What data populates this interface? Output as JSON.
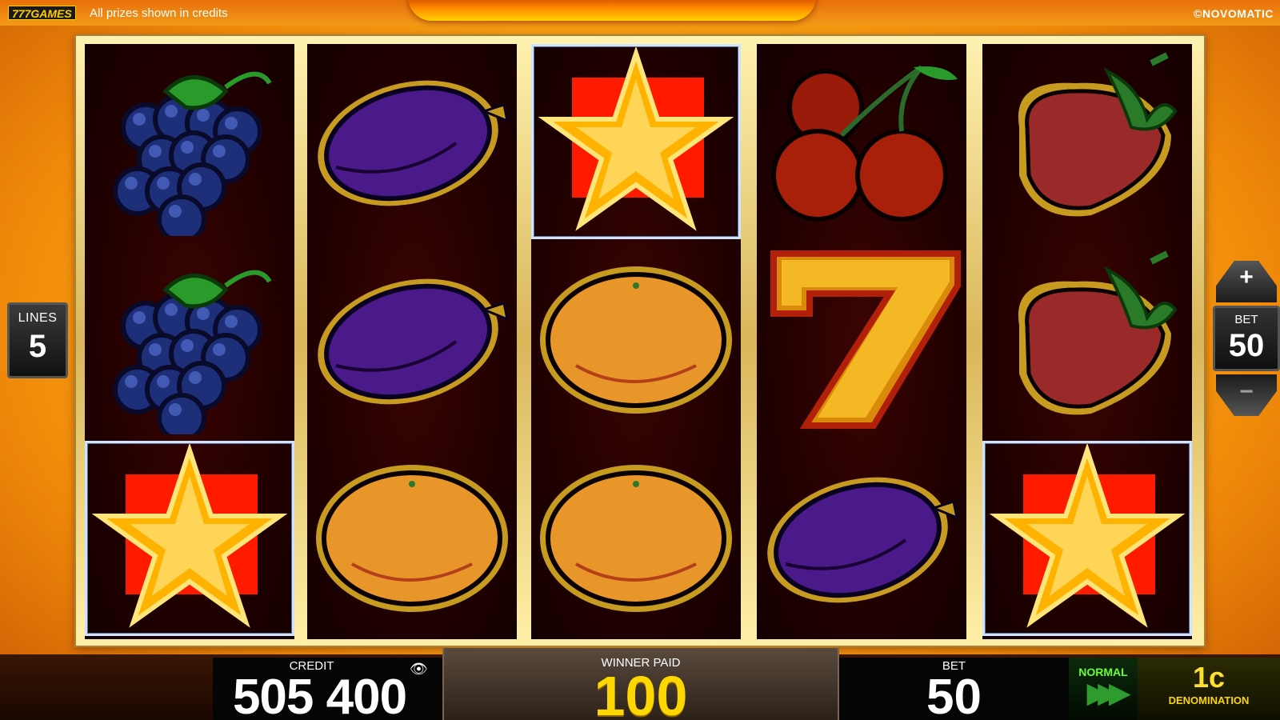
{
  "header": {
    "brand": "777GAMES",
    "prizes_note": "All prizes shown in credits",
    "copyright": "©NOVOMATIC"
  },
  "lines": {
    "label": "LINES",
    "value": "5"
  },
  "bet_control": {
    "plus": "+",
    "label": "BET",
    "value": "50",
    "minus": "−"
  },
  "reels": [
    [
      "grapes",
      "grapes",
      "star"
    ],
    [
      "plum",
      "plum",
      "orange"
    ],
    [
      "star",
      "orange",
      "orange"
    ],
    [
      "cherries",
      "seven",
      "plum"
    ],
    [
      "strawberry",
      "strawberry",
      "star"
    ]
  ],
  "winning_cells": [
    [
      0,
      2
    ],
    [
      2,
      0
    ],
    [
      4,
      2
    ]
  ],
  "bottom_panel": {
    "credit_label": "CREDIT",
    "credit_value": "505 400",
    "winner_label": "WINNER PAID",
    "winner_value": "100",
    "bet_label": "BET",
    "bet_value": "50",
    "speed_label": "NORMAL",
    "speed_arrows": "▶▶▶",
    "denomination_value": "1c",
    "denomination_label": "DENOMINATION"
  }
}
